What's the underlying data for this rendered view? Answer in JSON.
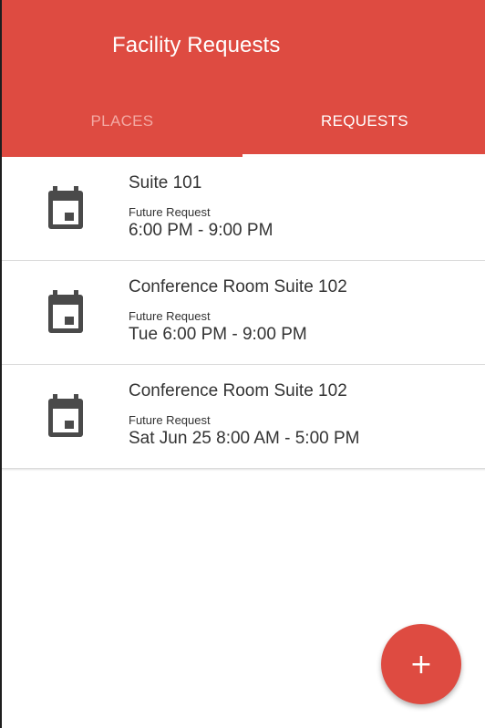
{
  "app": {
    "title": "Facility Requests"
  },
  "tabs": [
    {
      "label": "PLACES",
      "active": false
    },
    {
      "label": "REQUESTS",
      "active": true
    }
  ],
  "requests": [
    {
      "title": "Suite 101",
      "status": "Future Request",
      "time": "6:00 PM - 9:00 PM",
      "icon": "calendar-icon"
    },
    {
      "title": "Conference Room Suite 102",
      "status": "Future Request",
      "time": "Tue 6:00 PM - 9:00 PM",
      "icon": "calendar-icon"
    },
    {
      "title": "Conference Room Suite 102",
      "status": "Future Request",
      "time": "Sat Jun 25 8:00 AM - 5:00 PM",
      "icon": "calendar-icon"
    }
  ],
  "fab": {
    "label": "+",
    "icon": "plus-icon"
  },
  "colors": {
    "primary": "#de4b41",
    "inactive_tab": "#f3a9a3",
    "icon": "#4a4a4a",
    "text": "#333333"
  }
}
